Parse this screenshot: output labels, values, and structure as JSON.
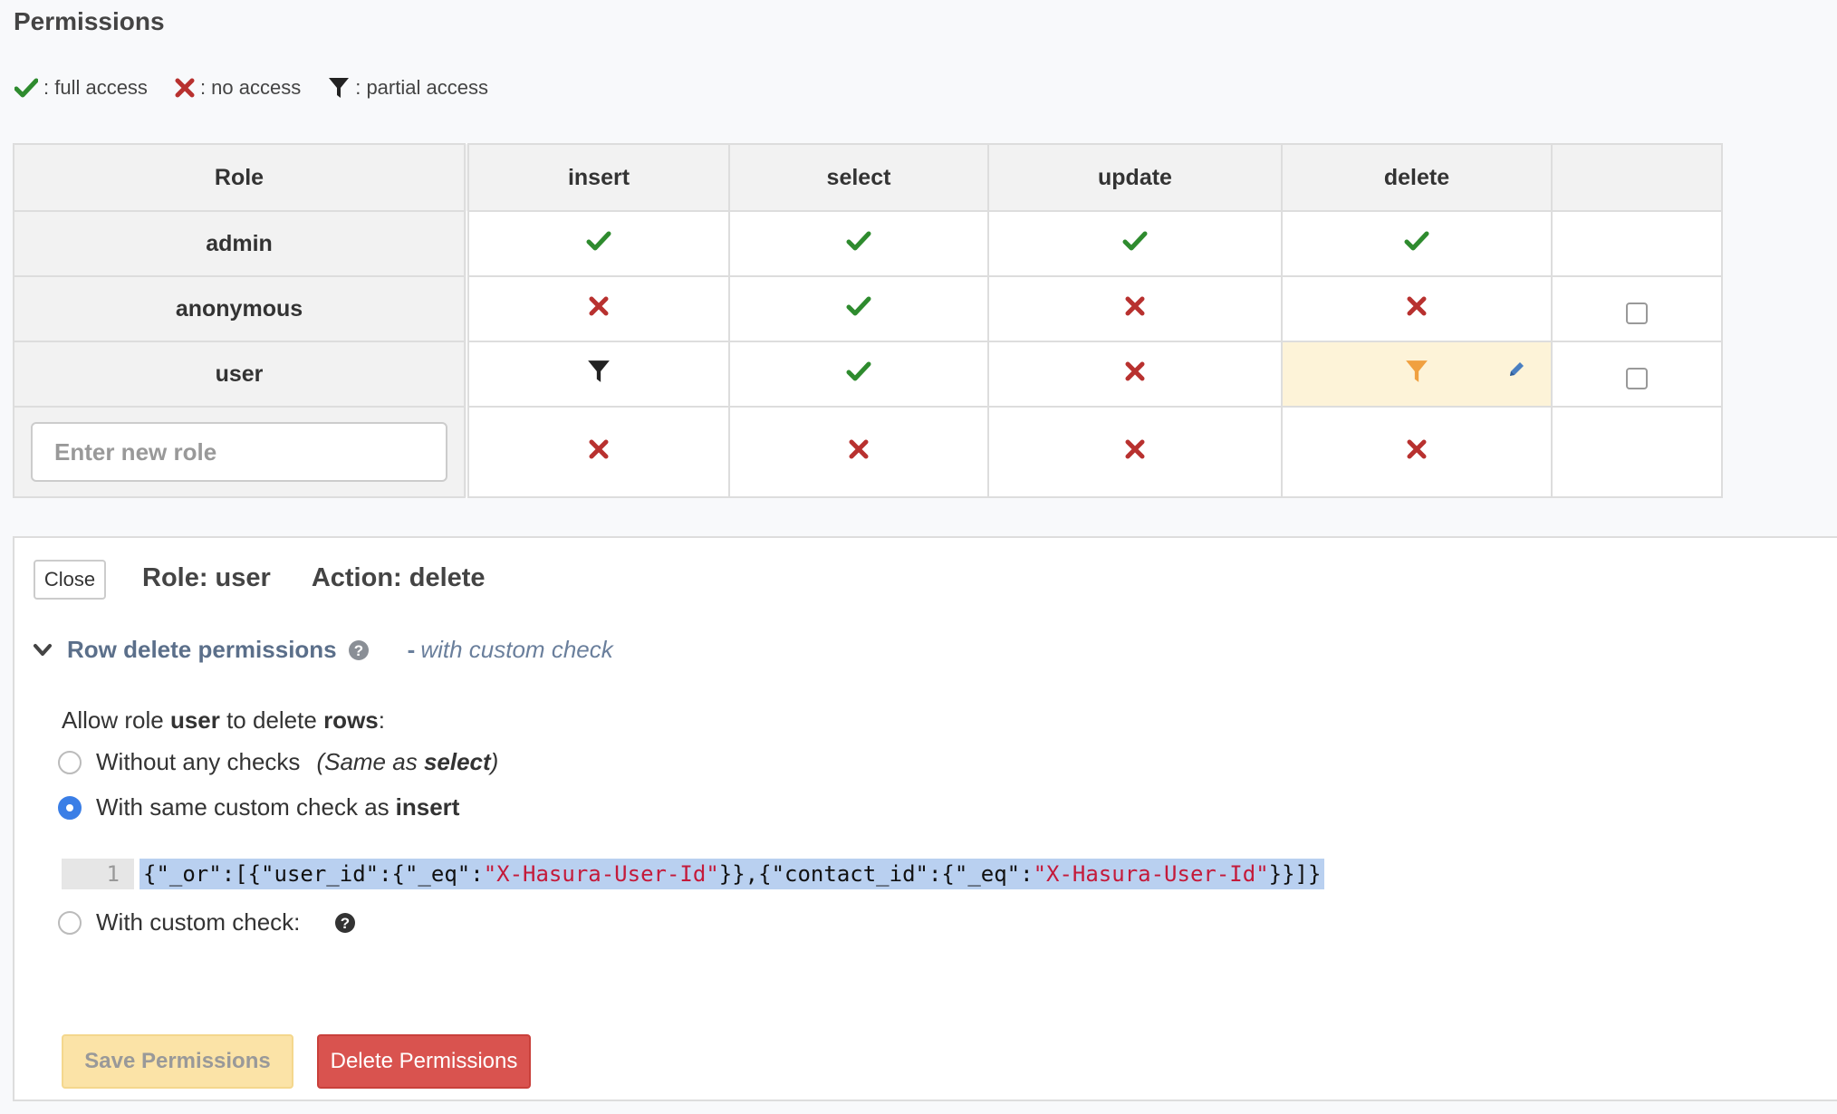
{
  "page": {
    "title": "Permissions"
  },
  "legend": [
    {
      "icon": "check-icon",
      "label": ": full access"
    },
    {
      "icon": "cross-icon",
      "label": ": no access"
    },
    {
      "icon": "filter-icon",
      "label": ": partial access"
    }
  ],
  "table": {
    "headers": [
      "Role",
      "insert",
      "select",
      "update",
      "delete",
      ""
    ],
    "rows": [
      {
        "role": "admin",
        "cells": [
          "full",
          "full",
          "full",
          "full"
        ]
      },
      {
        "role": "anonymous",
        "cells": [
          "none",
          "full",
          "none",
          "none"
        ]
      },
      {
        "role": "user",
        "cells": [
          "partial",
          "full",
          "none",
          "partial"
        ]
      }
    ],
    "new_role_placeholder": "Enter new role",
    "new_role_cells": [
      "none",
      "none",
      "none",
      "none"
    ]
  },
  "panel": {
    "close_label": "Close",
    "role_label": "Role: user",
    "action_label": "Action: delete",
    "section_title": "Row delete permissions",
    "section_dash": "-",
    "section_note": "with custom check",
    "allow_prefix": "Allow role ",
    "allow_role": "user",
    "allow_mid": " to delete ",
    "allow_rows": "rows",
    "allow_suffix": ":",
    "option_none": "Without any checks",
    "option_none_note_prefix": "(Same as ",
    "option_none_note_bold": "select",
    "option_none_note_suffix": ")",
    "option_same": "With same custom check as ",
    "option_same_bold": "insert",
    "code_line_number": "1",
    "code_parts": [
      "{\"_or\":[{\"user_id\":{\"_eq\":",
      "\"X-Hasura-User-Id\"",
      "}},{\"contact_id\":{\"_eq\":",
      "\"X-Hasura-User-Id\"",
      "}}]}"
    ],
    "option_custom": "With custom check:",
    "save_label": "Save Permissions",
    "delete_label": "Delete Permissions"
  },
  "colors": {
    "full": "#2e8b2e",
    "none": "#b8312f",
    "partial_active": "#f0a040",
    "link": "#5b6f8a",
    "danger": "#d9534f"
  }
}
